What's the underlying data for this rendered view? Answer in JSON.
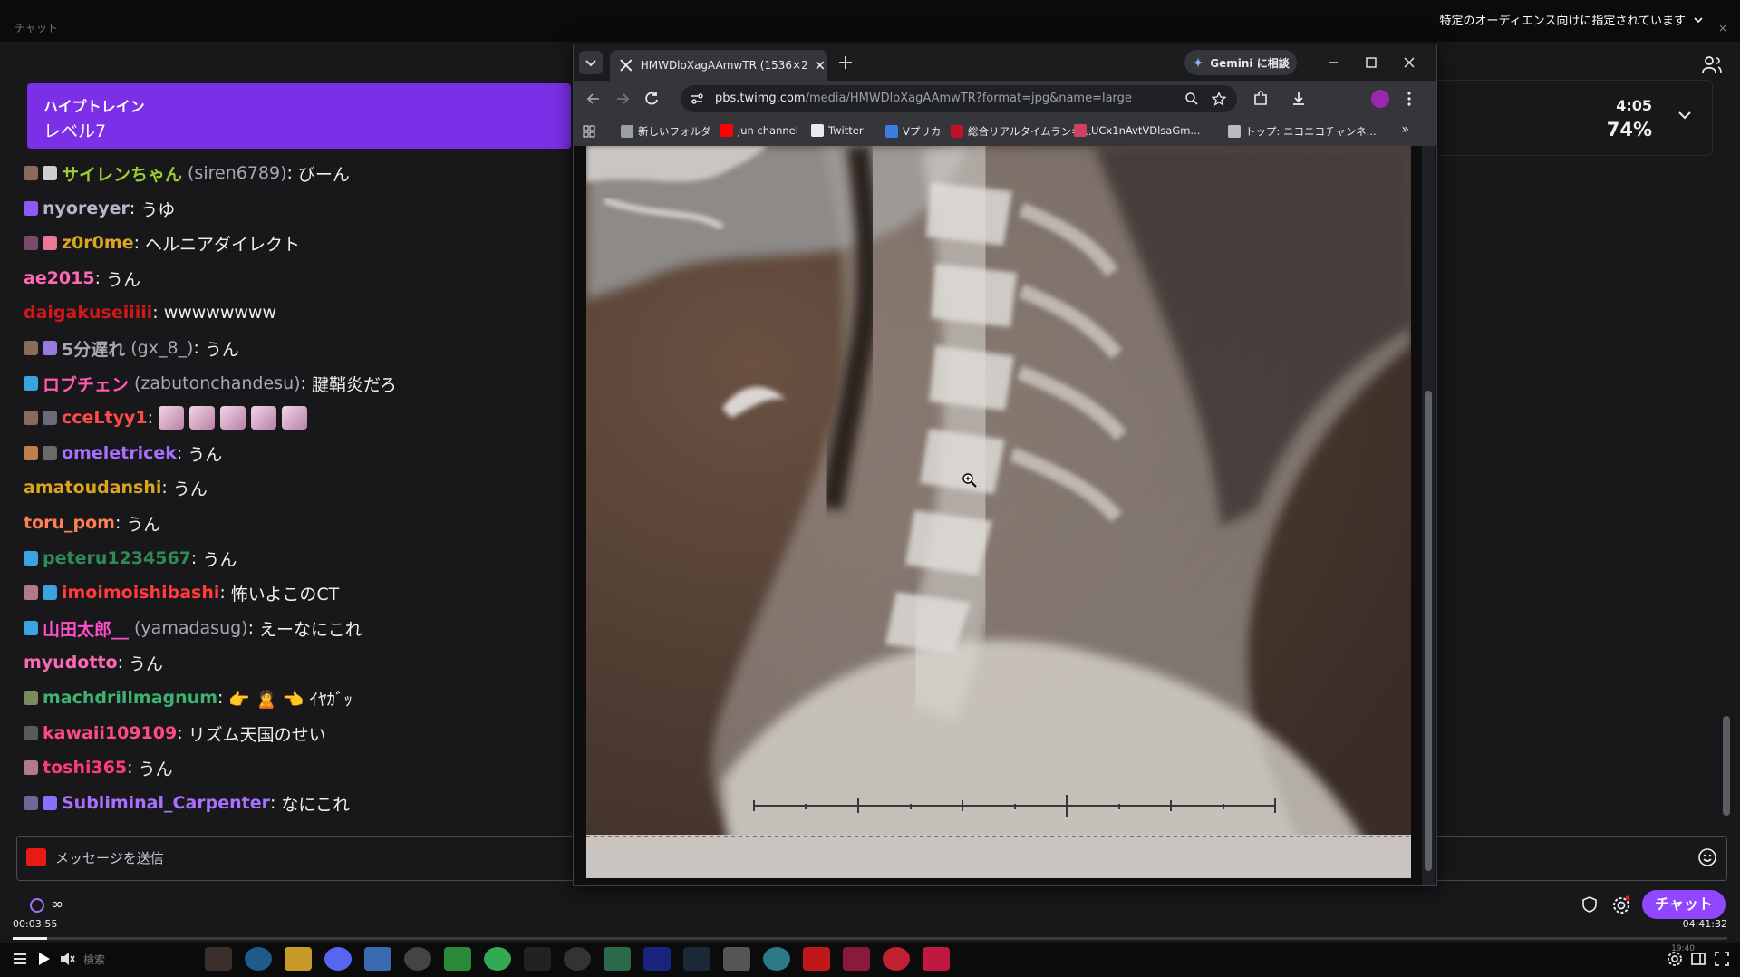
{
  "topbar": {
    "label": "チャット",
    "audience": "特定のオーディエンス向けに指定されています"
  },
  "hype_train": {
    "title": "ハイプトレイン",
    "level": "レベル7",
    "time_left": "4:05",
    "progress": "74%"
  },
  "chat": {
    "messages": [
      {
        "badges": [
          "#8a6a5a",
          "#cfcfcf"
        ],
        "user": "サイレンちゃん",
        "alias": "(siren6789)",
        "color": "#9acd32",
        "text": "びーん"
      },
      {
        "badges": [
          "#8a5cf6"
        ],
        "user": "nyoreyer",
        "alias": "",
        "color": "#b5b5c8",
        "text": "うゆ"
      },
      {
        "badges": [
          "#7a4a6a",
          "#e8799a"
        ],
        "user": "z0r0me",
        "alias": "",
        "color": "#daa520",
        "text": "ヘルニアダイレクト"
      },
      {
        "badges": [],
        "user": "ae2015",
        "alias": "",
        "color": "#ff69b4",
        "text": "うん"
      },
      {
        "badges": [],
        "user": "daigakuseiiiii",
        "alias": "",
        "color": "#d01818",
        "text": "wwwwwwww"
      },
      {
        "badges": [
          "#8a6a5a",
          "#9a7ae0"
        ],
        "user": "5分遅れ",
        "alias": "(gx_8_)",
        "color": "#a8a8b2",
        "text": "うん"
      },
      {
        "badges": [
          "#3aa3e0"
        ],
        "user": "ロブチェン",
        "alias": "(zabutonchandesu)",
        "color": "#ff5ab0",
        "text": "腱鞘炎だろ"
      },
      {
        "badges": [
          "#8a6a5a",
          "#6a6a7a"
        ],
        "user": "cceLtyy1",
        "alias": "",
        "color": "#ff4a4a",
        "text": ""
      },
      {
        "badges": [
          "#c0804a",
          "#6a6a6a"
        ],
        "user": "omeletricek",
        "alias": "",
        "color": "#a970ff",
        "text": "うん"
      },
      {
        "badges": [],
        "user": "amatoudanshi",
        "alias": "",
        "color": "#daa520",
        "text": "うん"
      },
      {
        "badges": [],
        "user": "toru_pom",
        "alias": "",
        "color": "#ff7f50",
        "text": "うん"
      },
      {
        "badges": [
          "#3aa3e0"
        ],
        "user": "peteru1234567",
        "alias": "",
        "color": "#2e8b57",
        "text": "うん"
      },
      {
        "badges": [
          "#b07a8a",
          "#3aa3e0"
        ],
        "user": "imoimoishibashi",
        "alias": "",
        "color": "#ff3b3b",
        "text": "怖いよこのCT"
      },
      {
        "badges": [
          "#3aa3e0"
        ],
        "user": "山田太郎__",
        "alias": "(yamadasug)",
        "color": "#ff4fc8",
        "text": "えーなにこれ"
      },
      {
        "badges": [],
        "user": "myudotto",
        "alias": "",
        "color": "#ff69b4",
        "text": "うん"
      },
      {
        "badges": [
          "#7a8a5a"
        ],
        "user": "machdrillmagnum",
        "alias": "",
        "color": "#3cb371",
        "text": "👉 🙎 👈 ｲﾔｶﾞｯ"
      },
      {
        "badges": [
          "#5a5a5a"
        ],
        "user": "kawaii109109",
        "alias": "",
        "color": "#ff4a8a",
        "text": "リズム天国のせい"
      },
      {
        "badges": [
          "#b07a8a"
        ],
        "user": "toshi365",
        "alias": "",
        "color": "#ff3a7a",
        "text": "うん"
      },
      {
        "badges": [
          "#6a6a9a",
          "#8a70ff"
        ],
        "user": "Subliminal_Carpenter",
        "alias": "",
        "color": "#a970ff",
        "text": "なにこれ"
      }
    ],
    "input_placeholder": "メッセージを送信",
    "infinity": "∞",
    "chat_button": "チャット"
  },
  "player": {
    "elapsed": "00:03:55",
    "total": "04:41:32",
    "search_label": "検索",
    "clock": "19:40",
    "progress_fraction": 0.02
  },
  "browser": {
    "tab_title": "HMWDloXagAAmwTR (1536×2",
    "gemini_label": "Gemini に相談",
    "url_host": "pbs.twimg.com",
    "url_path": "/media/HMWDloXagAAmwTR?format=jpg&name=large",
    "bookmarks": [
      {
        "label": "新しいフォルダ",
        "icon": "folder-icon",
        "color": "#9aa0a6"
      },
      {
        "label": "jun channel",
        "icon": "youtube-icon",
        "color": "#ff0000"
      },
      {
        "label": "Twitter",
        "icon": "x-logo-icon",
        "color": "#e8eaed"
      },
      {
        "label": "Vプリカ",
        "icon": "vpreca-icon",
        "color": "#3b7de0"
      },
      {
        "label": "総合リアルタイムランキ...",
        "icon": "ranking-icon",
        "color": "#c0102a"
      },
      {
        "label": "UCx1nAvtVDlsaGm...",
        "icon": "chart-icon",
        "color": "#d04060"
      },
      {
        "label": "トップ: ニコニコチャンネ...",
        "icon": "niconico-icon",
        "color": "#bbbbbb"
      }
    ]
  },
  "colors": {
    "hype": "#7b2fe6",
    "accent": "#9147ff",
    "chat_bg": "#18181b"
  }
}
